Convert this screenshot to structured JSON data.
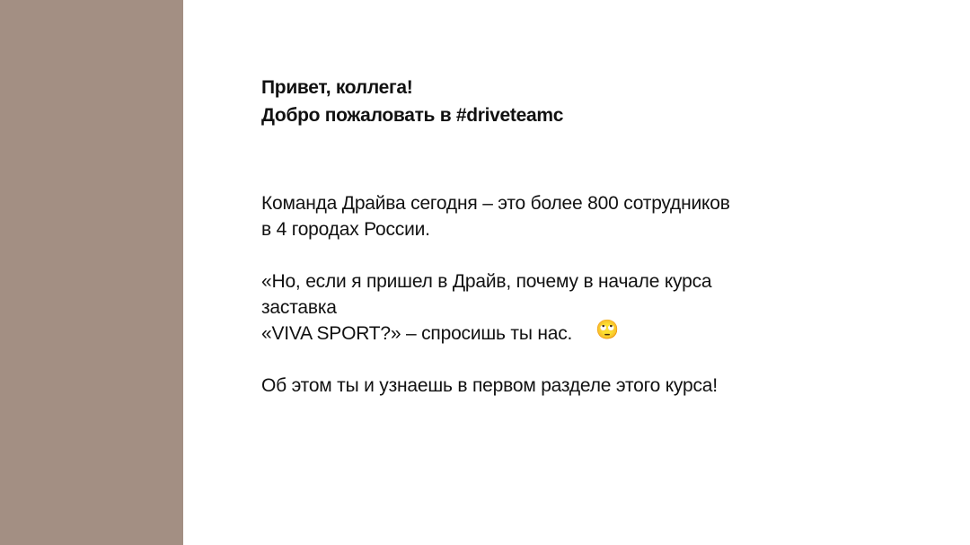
{
  "heading": {
    "line1": "Привет, коллега!",
    "line2": "Добро пожаловать в  #driveteamc"
  },
  "paragraph1": {
    "line1": "Команда Драйва сегодня – это более 800 сотрудников",
    "line2": "в 4 городах России."
  },
  "paragraph2": {
    "line1": "«Но, если я пришел в Драйв, почему в начале курса",
    "line2": "заставка",
    "line3": "«VIVA SPORT?» – спросишь ты нас.",
    "emoji": "🙄",
    "emoji_icon": "eye-roll-emoji-icon"
  },
  "paragraph3": {
    "line1": "Об этом ты и узнаешь в первом разделе этого курса!"
  },
  "colors": {
    "side_panel": "#a38f83",
    "background": "#ffffff",
    "text": "#111111"
  }
}
